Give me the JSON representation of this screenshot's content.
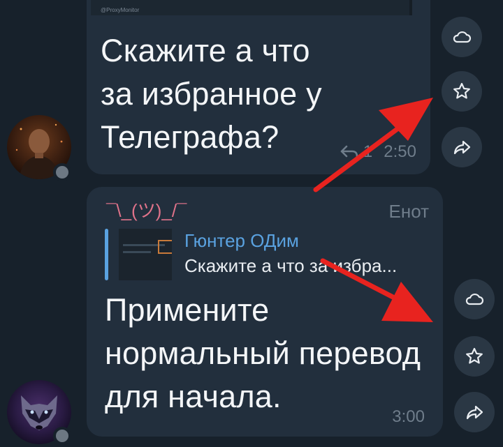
{
  "message1": {
    "forwarded_source": "@ProxyMonitor",
    "text": "Скажите а что\nза избранное у\nТелеграфа?",
    "replies_count": "1",
    "time": "2:50"
  },
  "message2": {
    "sender_name": "Енот",
    "kaomoji": "¯\\_(ツ)_/¯",
    "reply": {
      "author": "Гюнтер ОДим",
      "text": "Скажите а что за избра..."
    },
    "text": "Примените\nнормальный перевод\nдля начала.",
    "time": "3:00"
  },
  "icons": {
    "cloud": "cloud-icon",
    "star": "star-icon",
    "share": "share-icon",
    "reply": "reply-icon"
  },
  "colors": {
    "background": "#17212b",
    "bubble": "#222f3d",
    "accent_link": "#5aa2e0",
    "kaomoji": "#e0738a",
    "annotation_arrow": "#e8231f"
  }
}
